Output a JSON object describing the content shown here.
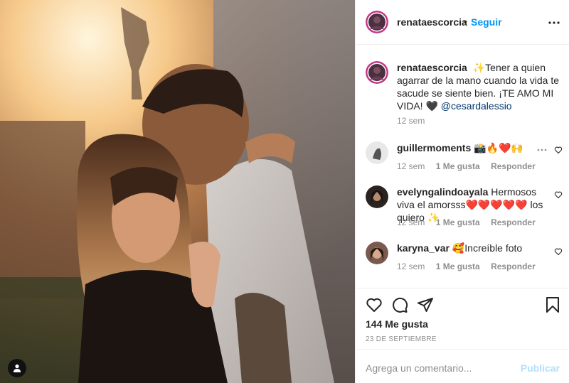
{
  "post": {
    "author": "renataescorcia",
    "follow_label": "Seguir",
    "separator": "•"
  },
  "caption": {
    "username": "renataescorcia",
    "text": "✨Tener a quien agarrar de la mano cuando la vida te sacude se siente bien. ¡TE AMO MI VIDA! 🖤",
    "mention": "@cesardalessio",
    "time": "12 sem"
  },
  "comments": [
    {
      "username": "guillermoments",
      "text": "📸🔥❤️🙌",
      "time": "12 sem",
      "likes": "1 Me gusta",
      "reply": "Responder"
    },
    {
      "username": "evelyngalindoayala",
      "text": "Hermosos viva el amorsss❤️❤️❤️❤️❤️ los quiero ✨",
      "time": "12 sem",
      "likes": "1 Me gusta",
      "reply": "Responder"
    },
    {
      "username": "karyna_var",
      "text": "🥰Increíble foto",
      "time": "12 sem",
      "likes": "1 Me gusta",
      "reply": "Responder"
    }
  ],
  "stats": {
    "likes": "144 Me gusta",
    "date": "23 DE SEPTIEMBRE"
  },
  "composer": {
    "placeholder": "Agrega un comentario...",
    "publish": "Publicar"
  },
  "icons": {
    "like": "heart-icon",
    "comment": "comment-icon",
    "share": "paper-plane-icon",
    "save": "bookmark-icon",
    "more": "more-dots-icon",
    "user_tag": "user-icon"
  },
  "colors": {
    "link_blue": "#0095f6",
    "mention": "#00376b",
    "muted": "#8e8e8e",
    "publish_disabled": "#b2dffc"
  }
}
